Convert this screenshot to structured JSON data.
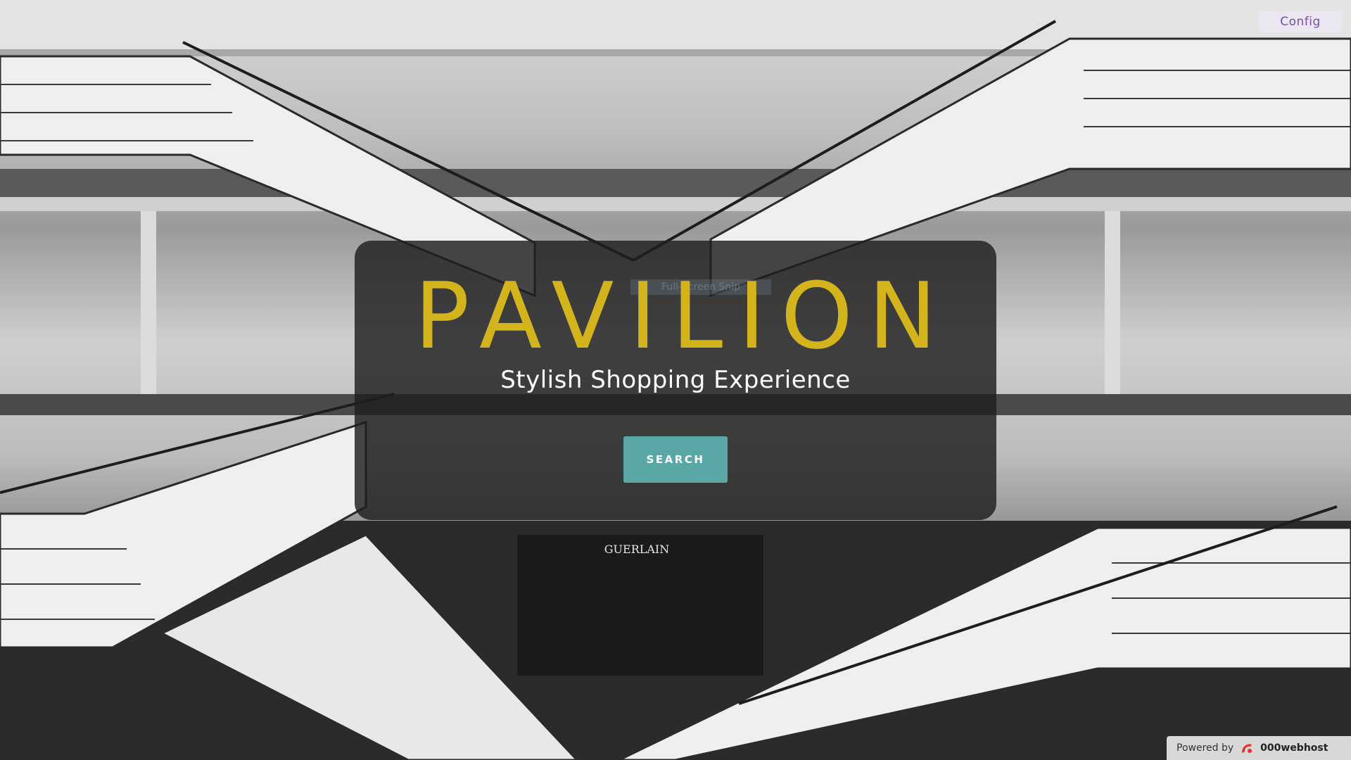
{
  "config_button": {
    "label": "Config"
  },
  "hero": {
    "title": "PAVILION",
    "subtitle": "Stylish Shopping Experience",
    "search_label": "SEARCH",
    "faint_overlay_text": "Full-Screen Snip"
  },
  "footer": {
    "powered_prefix": "Powered by",
    "brand": "000webhost"
  },
  "background": {
    "description_icon": "shopping-mall-escalators-photo",
    "store_sign": "GUERLAIN"
  },
  "colors": {
    "title": "#d4b41c",
    "search_button": "#5aa8a5",
    "config_text": "#7b4fa8",
    "panel": "rgba(30,30,30,0.82)"
  }
}
